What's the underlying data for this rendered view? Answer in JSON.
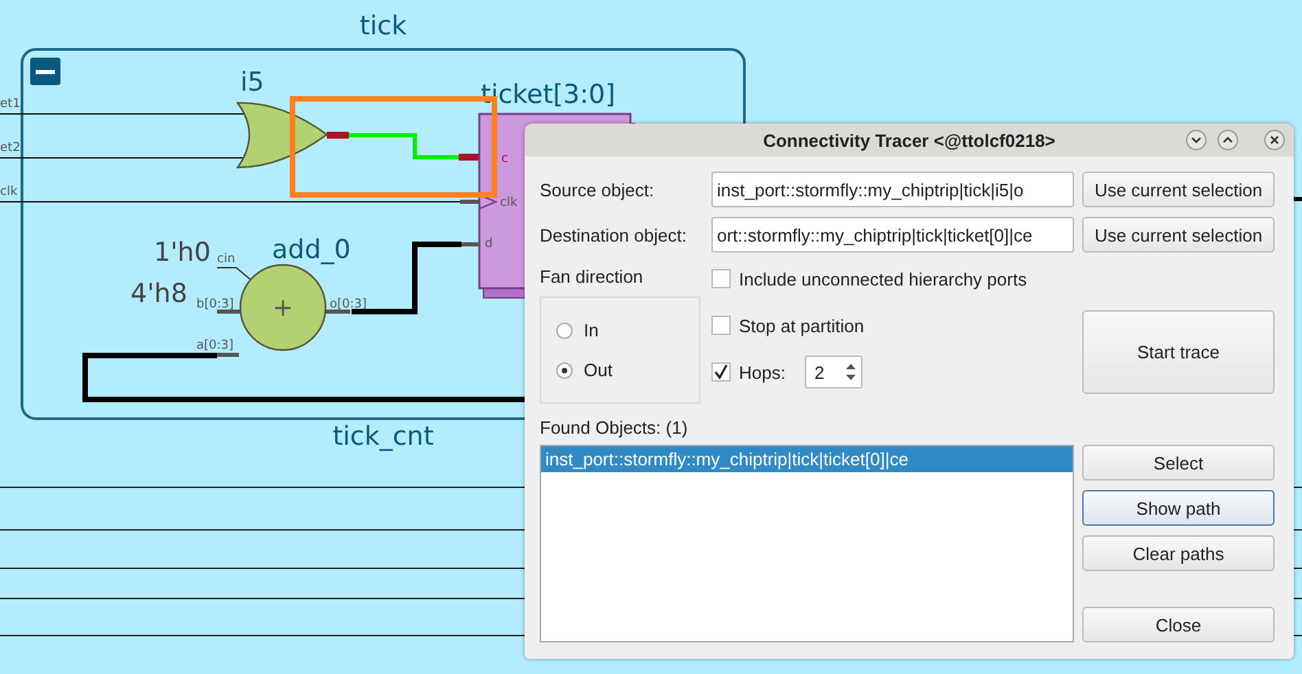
{
  "schematic": {
    "module_label": "tick",
    "bottom_label": "tick_cnt",
    "input_labels": [
      "et1",
      "et2",
      "clk"
    ],
    "path_highlighted": true,
    "gate": {
      "name": "i5"
    },
    "register": {
      "name": "ticket[3:0]",
      "pins": [
        "c",
        "clk",
        "d"
      ]
    },
    "adder": {
      "name": "add_0",
      "symbol": "+",
      "constants": [
        "1'h0",
        "4'h8"
      ],
      "pins": [
        "cin",
        "b[0:3]",
        "o[0:3]",
        "a[0:3]"
      ]
    }
  },
  "dialog": {
    "title": "Connectivity Tracer <@ttolcf0218>",
    "source": {
      "label": "Source object:",
      "value": "inst_port::stormfly::my_chiptrip|tick|i5|o",
      "button": "Use current selection"
    },
    "destination": {
      "label": "Destination object:",
      "value": "ort::stormfly::my_chiptrip|tick|ticket[0]|ce",
      "button": "Use current selection"
    },
    "fan_direction": {
      "label": "Fan direction",
      "options": [
        {
          "label": "In",
          "selected": false
        },
        {
          "label": "Out",
          "selected": true
        }
      ]
    },
    "options": [
      {
        "label": "Include unconnected hierarchy ports",
        "checked": false
      },
      {
        "label": "Stop at partition",
        "checked": false
      }
    ],
    "hops": {
      "label": "Hops:",
      "checked": true,
      "value": "2"
    },
    "start_button": "Start trace",
    "found": {
      "label": "Found Objects: (1)",
      "items": [
        {
          "text": "inst_port::stormfly::my_chiptrip|tick|ticket[0]|ce",
          "selected": true
        }
      ]
    },
    "buttons": [
      {
        "label": "Select",
        "focused": false
      },
      {
        "label": "Show path",
        "focused": true
      },
      {
        "label": "Clear paths",
        "focused": false
      },
      {
        "label": "Close",
        "focused": false
      }
    ]
  }
}
